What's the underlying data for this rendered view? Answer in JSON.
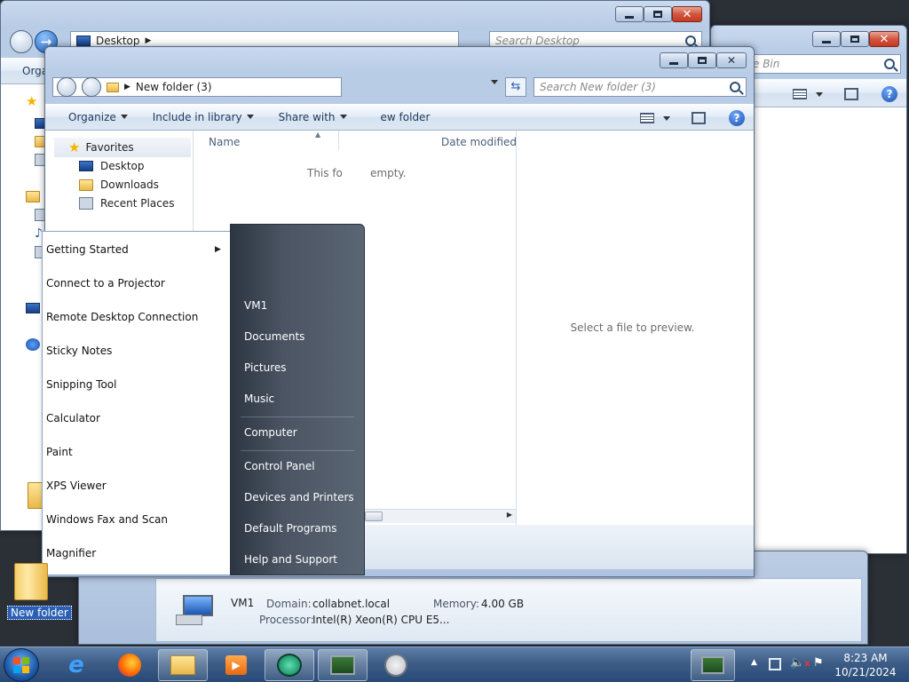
{
  "window_desktop": {
    "address": "Desktop",
    "search_placeholder": "Search Desktop",
    "organize_partial": "Orga"
  },
  "window_recycle": {
    "search_partial": "e Bin"
  },
  "window_newfolder": {
    "address": "New folder (3)",
    "search_placeholder": "Search New folder (3)",
    "toolbar": {
      "organize": "Organize",
      "include_in_library": "Include in library",
      "share_with": "Share with",
      "new_folder_partial": "ew folder"
    },
    "nav": {
      "favorites": "Favorites",
      "items": [
        "Desktop",
        "Downloads",
        "Recent Places"
      ]
    },
    "columns": {
      "name": "Name",
      "date_modified": "Date modified"
    },
    "empty_text_a": "This fo",
    "empty_text_b": "empty.",
    "preview_text": "Select a file to preview."
  },
  "start_menu": {
    "programs": [
      "Getting Started",
      "Connect to a Projector",
      "Remote Desktop Connection",
      "Sticky Notes",
      "Snipping Tool",
      "Calculator",
      "Paint",
      "XPS Viewer",
      "Windows Fax and Scan",
      "Magnifier"
    ],
    "right": [
      "VM1",
      "Documents",
      "Pictures",
      "Music",
      "Computer",
      "Control Panel",
      "Devices and Printers",
      "Default Programs",
      "Help and Support"
    ]
  },
  "details_pane": {
    "name": "VM1",
    "domain_label": "Domain:",
    "domain_value": "collabnet.local",
    "memory_label": "Memory:",
    "memory_value": "4.00 GB",
    "processor_label": "Processor:",
    "processor_value": "Intel(R) Xeon(R) CPU E5..."
  },
  "desktop_icon": {
    "label": "New folder"
  },
  "taskbar": {
    "icons": [
      "start-orb-icon",
      "ie-icon",
      "firefox-icon",
      "explorer-icon",
      "media-player-icon",
      "app-icon",
      "server-manager-icon",
      "system-tool-icon"
    ],
    "time": "8:23 AM",
    "date": "10/21/2024"
  }
}
